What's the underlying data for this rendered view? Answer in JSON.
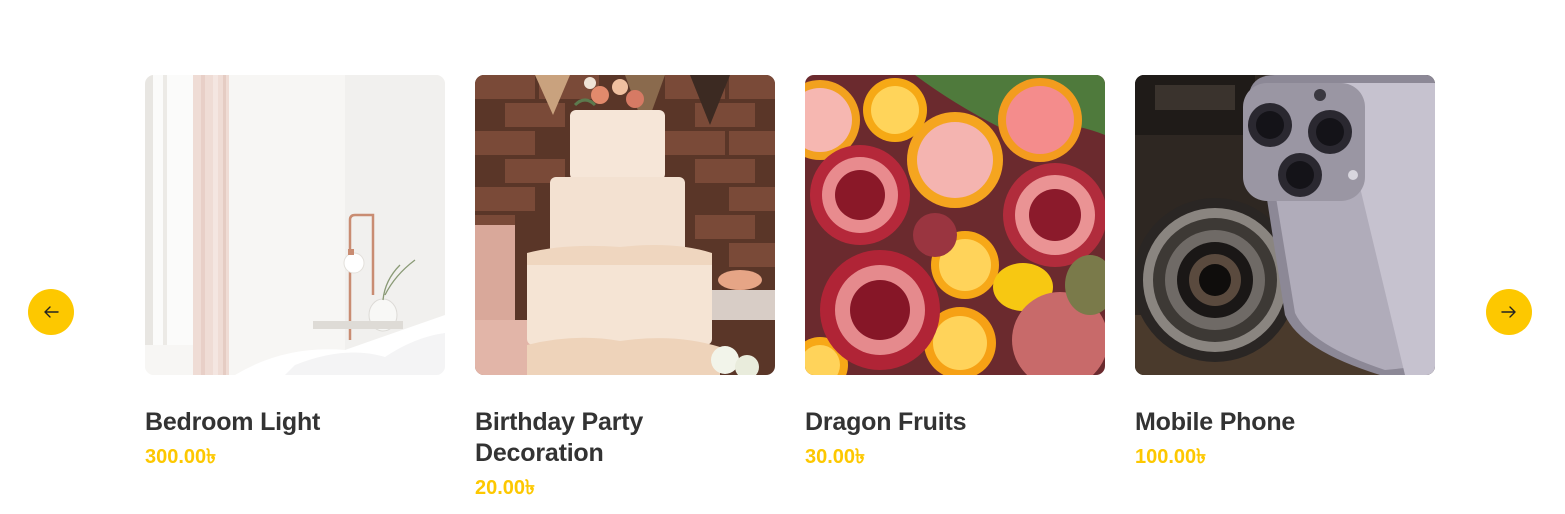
{
  "carousel": {
    "prev_icon": "arrow-left-icon",
    "next_icon": "arrow-right-icon",
    "accent_color": "#fdc800",
    "products": [
      {
        "title": "Bedroom Light",
        "price": "300.00৳",
        "image": "bedroom-lamp-photo"
      },
      {
        "title": "Birthday Party Decoration",
        "price": "20.00৳",
        "image": "wedding-cake-photo"
      },
      {
        "title": "Dragon Fruits",
        "price": "30.00৳",
        "image": "fruits-photo"
      },
      {
        "title": "Mobile Phone",
        "price": "100.00৳",
        "image": "phone-camera-photo"
      }
    ]
  }
}
